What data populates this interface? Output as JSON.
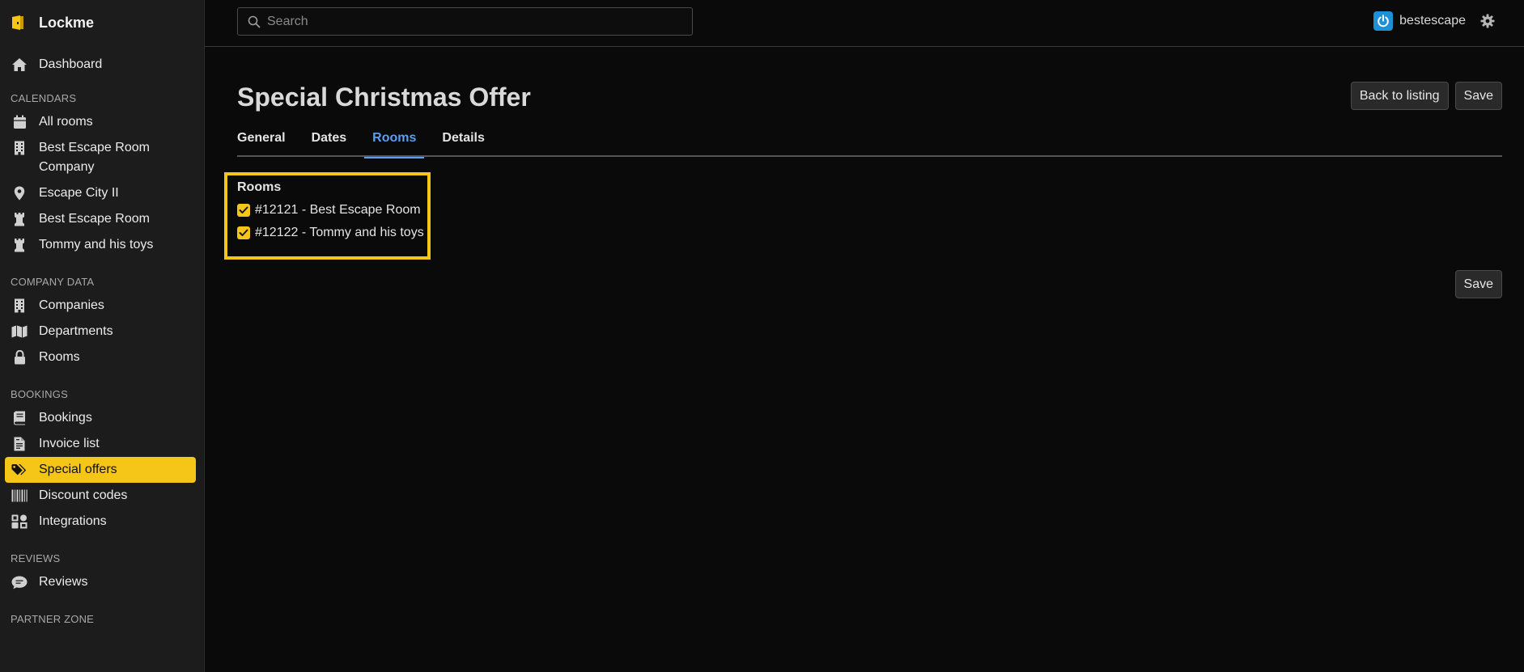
{
  "app": {
    "name": "Lockme"
  },
  "search": {
    "placeholder": "Search"
  },
  "user": {
    "name": "bestescape"
  },
  "sidebar": {
    "dashboard": "Dashboard",
    "calendars_head": "CALENDARS",
    "calendars": [
      {
        "label": "All rooms",
        "icon": "calendar-icon"
      },
      {
        "label": "Best Escape Room Company",
        "icon": "building-icon"
      },
      {
        "label": "Escape City II",
        "icon": "map-pin-icon"
      },
      {
        "label": "Best Escape Room",
        "icon": "chess-rook-icon"
      },
      {
        "label": "Tommy and his toys",
        "icon": "chess-rook-icon"
      }
    ],
    "company_head": "COMPANY DATA",
    "company": [
      {
        "label": "Companies",
        "icon": "building-icon"
      },
      {
        "label": "Departments",
        "icon": "map-icon"
      },
      {
        "label": "Rooms",
        "icon": "lock-icon"
      }
    ],
    "bookings_head": "BOOKINGS",
    "bookings": [
      {
        "label": "Bookings",
        "icon": "book-icon"
      },
      {
        "label": "Invoice list",
        "icon": "invoice-icon"
      },
      {
        "label": "Special offers",
        "icon": "tags-icon"
      },
      {
        "label": "Discount codes",
        "icon": "barcode-icon"
      },
      {
        "label": "Integrations",
        "icon": "puzzle-icon"
      }
    ],
    "reviews_head": "REVIEWS",
    "reviews": [
      {
        "label": "Reviews",
        "icon": "comment-icon"
      }
    ],
    "partner_head": "PARTNER ZONE"
  },
  "page": {
    "title": "Special Christmas Offer",
    "back_label": "Back to listing",
    "save_label": "Save",
    "save_bottom_label": "Save"
  },
  "tabs": [
    "General",
    "Dates",
    "Rooms",
    "Details"
  ],
  "active_tab": "Rooms",
  "rooms": {
    "title": "Rooms",
    "items": [
      {
        "label": "#12121 - Best Escape Room",
        "checked": true
      },
      {
        "label": "#12122 - Tommy and his toys",
        "checked": true
      }
    ]
  },
  "colors": {
    "accent": "#f5c518",
    "active_tab": "#5a9ef8",
    "power": "#1f8fd6"
  }
}
